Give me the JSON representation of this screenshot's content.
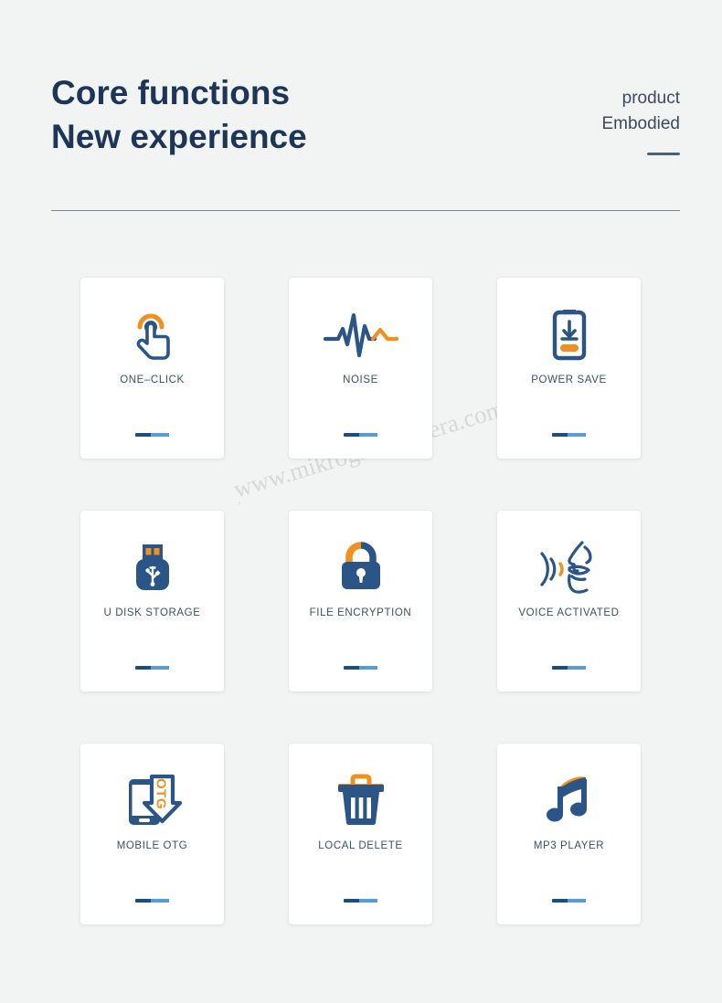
{
  "header": {
    "title_line1": "Core functions",
    "title_line2": "New experience",
    "sub_line1": "product",
    "sub_line2": "Embodied"
  },
  "watermark": {
    "text": "www.mikrogizlikamera.com",
    "tick": ","
  },
  "colors": {
    "background": "#f2f4f3",
    "navy": "#2b5586",
    "navy_dark": "#1d3557",
    "orange": "#f0901e",
    "bar_dark": "#1d4e77",
    "bar_light": "#5b9bd5",
    "label": "#3d4f68",
    "divider": "#7b8494"
  },
  "cards": [
    {
      "label": "ONE–CLICK",
      "icon": "one-click-tap-icon"
    },
    {
      "label": "NOISE",
      "icon": "noise-waveform-icon"
    },
    {
      "label": "POWER SAVE",
      "icon": "battery-download-icon"
    },
    {
      "label": "U DISK STORAGE",
      "icon": "usb-flash-drive-icon"
    },
    {
      "label": "FILE ENCRYPTION",
      "icon": "padlock-icon"
    },
    {
      "label": "VOICE ACTIVATED",
      "icon": "voice-face-waves-icon"
    },
    {
      "label": "MOBILE OTG",
      "icon": "mobile-otg-arrow-icon"
    },
    {
      "label": "LOCAL DELETE",
      "icon": "trash-can-icon"
    },
    {
      "label": "MP3 PLAYER",
      "icon": "music-note-icon"
    }
  ]
}
